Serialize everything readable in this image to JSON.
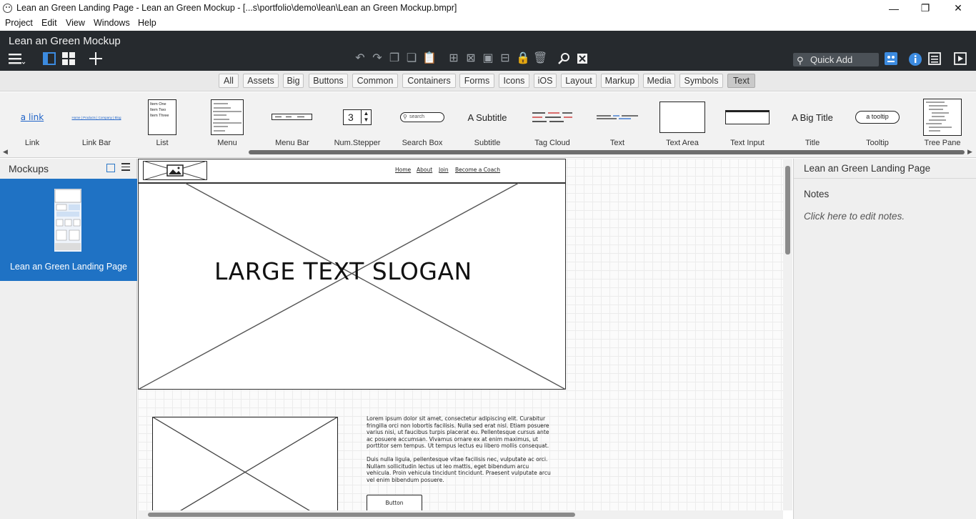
{
  "window": {
    "title": "Lean an Green Landing Page - Lean an Green Mockup - [...s\\portfolio\\demo\\lean\\Lean an Green Mockup.bmpr]",
    "minimize": "—",
    "maximize": "❐",
    "close": "✕"
  },
  "menu": [
    "Project",
    "Edit",
    "View",
    "Windows",
    "Help"
  ],
  "project_title": "Lean an Green Mockup",
  "quick_add": {
    "placeholder": "Quick Add"
  },
  "filters": [
    {
      "label": "All"
    },
    {
      "label": "Assets"
    },
    {
      "label": "Big"
    },
    {
      "label": "Buttons"
    },
    {
      "label": "Common"
    },
    {
      "label": "Containers"
    },
    {
      "label": "Forms"
    },
    {
      "label": "Icons"
    },
    {
      "label": "iOS"
    },
    {
      "label": "Layout"
    },
    {
      "label": "Markup"
    },
    {
      "label": "Media"
    },
    {
      "label": "Symbols"
    },
    {
      "label": "Text",
      "active": true
    }
  ],
  "components": [
    {
      "label": "Link",
      "preview": "a link"
    },
    {
      "label": "Link Bar",
      "preview": "Home | Products | Company | Blog"
    },
    {
      "label": "List",
      "items": [
        "Item One",
        "Item Two",
        "Item Three"
      ]
    },
    {
      "label": "Menu"
    },
    {
      "label": "Menu Bar"
    },
    {
      "label": "Num.Stepper",
      "preview": "3"
    },
    {
      "label": "Search Box",
      "preview": "search"
    },
    {
      "label": "Subtitle",
      "preview": "A Subtitle"
    },
    {
      "label": "Tag Cloud"
    },
    {
      "label": "Text"
    },
    {
      "label": "Text Area"
    },
    {
      "label": "Text Input"
    },
    {
      "label": "Title",
      "preview": "A Big Title"
    },
    {
      "label": "Tooltip",
      "preview": "a tooltip"
    },
    {
      "label": "Tree Pane"
    }
  ],
  "left_panel": {
    "title": "Mockups",
    "items": [
      {
        "label": "Lean an Green Landing Page",
        "selected": true
      }
    ]
  },
  "mockup": {
    "nav": [
      "Home",
      "About",
      "Join",
      "Become a Coach"
    ],
    "hero_slogan": "LARGE TEXT SLOGAN",
    "para1": "Lorem ipsum dolor sit amet, consectetur adipiscing elit. Curabitur fringilla orci non lobortis facilisis. Nulla sed erat nisl. Etiam posuere varius nisi, ut faucibus turpis placerat eu. Pellentesque cursus ante ac posuere accumsan. Vivamus ornare ex at enim maximus, ut porttitor sem tempus. Ut tempus lectus eu libero mollis consequat.",
    "para2": "Duis nulla ligula, pellentesque vitae facilisis nec, vulputate ac orci. Nullam sollicitudin lectus ut leo mattis, eget bibendum arcu vehicula. Proin vehicula tincidunt tincidunt. Praesent vulputate arcu vel enim bibendum posuere.",
    "button": "Button"
  },
  "right_panel": {
    "title": "Lean an Green Landing Page",
    "notes_label": "Notes",
    "notes_placeholder": "Click here to edit notes."
  },
  "colors": {
    "accent": "#1f72c4",
    "dark_header": "#262a2e",
    "filter_active": "#c9c9c9"
  }
}
